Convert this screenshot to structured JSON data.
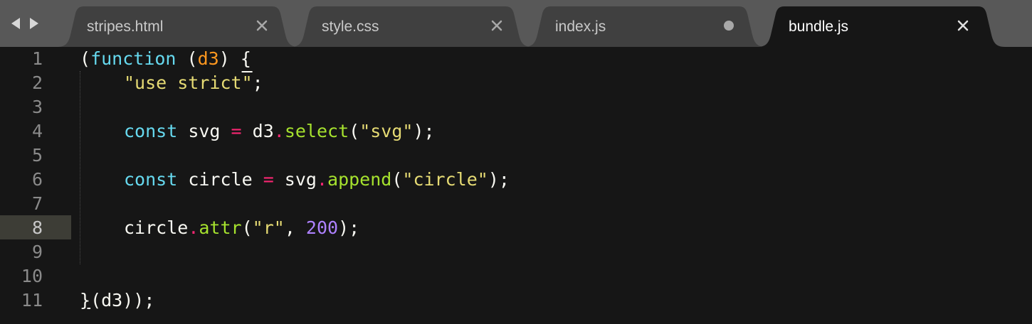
{
  "colors": {
    "tabbar_bg": "#585858",
    "tab_inactive_bg": "#404040",
    "tab_active_bg": "#161616",
    "editor_bg": "#161616",
    "keyword": "#66d9ef",
    "parameter": "#fd971f",
    "string": "#e6db74",
    "operator": "#f92672",
    "function": "#a6e22e",
    "number": "#ae81ff"
  },
  "nav": {
    "back_icon": "triangle-left",
    "forward_icon": "triangle-right"
  },
  "tabs": [
    {
      "label": "stripes.html",
      "state": "clean",
      "active": false
    },
    {
      "label": "style.css",
      "state": "clean",
      "active": false
    },
    {
      "label": "index.js",
      "state": "modified",
      "active": false
    },
    {
      "label": "bundle.js",
      "state": "clean",
      "active": true
    }
  ],
  "editor": {
    "current_line": 8,
    "line_numbers": [
      "1",
      "2",
      "3",
      "4",
      "5",
      "6",
      "7",
      "8",
      "9",
      "10",
      "11"
    ],
    "lines": [
      [
        {
          "t": "(",
          "c": "plain"
        },
        {
          "t": "function",
          "c": "kw"
        },
        {
          "t": " ",
          "c": "plain"
        },
        {
          "t": "(",
          "c": "plain"
        },
        {
          "t": "d3",
          "c": "param"
        },
        {
          "t": ") {",
          "c": "plain"
        }
      ],
      [
        {
          "t": "\"use strict",
          "c": "str"
        },
        {
          "t": "\"",
          "c": "str-overline"
        },
        {
          "t": ";",
          "c": "plain"
        }
      ],
      [],
      [
        {
          "t": "const",
          "c": "kw"
        },
        {
          "t": " svg ",
          "c": "plain"
        },
        {
          "t": "=",
          "c": "op"
        },
        {
          "t": " d3",
          "c": "plain"
        },
        {
          "t": ".",
          "c": "op"
        },
        {
          "t": "select",
          "c": "fn"
        },
        {
          "t": "(",
          "c": "plain"
        },
        {
          "t": "\"svg\"",
          "c": "str"
        },
        {
          "t": ");",
          "c": "plain"
        }
      ],
      [],
      [
        {
          "t": "const",
          "c": "kw"
        },
        {
          "t": " circle ",
          "c": "plain"
        },
        {
          "t": "=",
          "c": "op"
        },
        {
          "t": " svg",
          "c": "plain"
        },
        {
          "t": ".",
          "c": "op"
        },
        {
          "t": "append",
          "c": "fn"
        },
        {
          "t": "(",
          "c": "plain"
        },
        {
          "t": "\"circle\"",
          "c": "str"
        },
        {
          "t": ");",
          "c": "plain"
        }
      ],
      [],
      [
        {
          "t": "circle",
          "c": "plain"
        },
        {
          "t": ".",
          "c": "op"
        },
        {
          "t": "attr",
          "c": "fn"
        },
        {
          "t": "(",
          "c": "plain"
        },
        {
          "t": "\"r\"",
          "c": "str"
        },
        {
          "t": ", ",
          "c": "plain"
        },
        {
          "t": "200",
          "c": "num"
        },
        {
          "t": ");",
          "c": "plain"
        }
      ],
      [],
      [],
      [
        {
          "t": "}",
          "c": "plain-underline"
        },
        {
          "t": "(d3));",
          "c": "plain"
        }
      ]
    ],
    "indented_lines": [
      2,
      4,
      6,
      8
    ]
  }
}
